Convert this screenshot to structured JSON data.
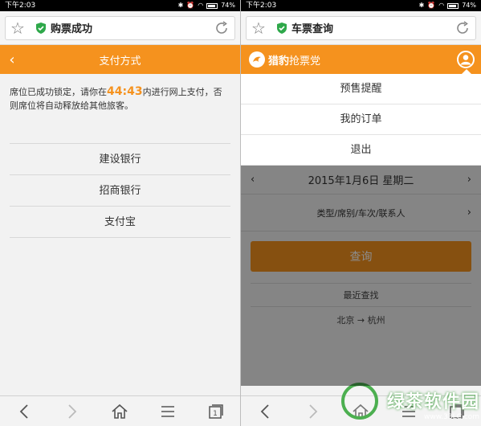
{
  "left": {
    "status": {
      "time": "下午2:03",
      "battery": "74%"
    },
    "urlbar": {
      "title": "购票成功"
    },
    "header": {
      "title": "支付方式"
    },
    "notice": {
      "before": "席位已成功锁定，请你在",
      "countdown": "44:43",
      "after": "内进行网上支付，否则席位将自动释放给其他旅客。"
    },
    "payment_options": [
      "建设银行",
      "招商银行",
      "支付宝"
    ],
    "bottomnav": {
      "tabs_count": "1"
    }
  },
  "right": {
    "status": {
      "time": "下午2:03",
      "battery": "74%"
    },
    "urlbar": {
      "title": "车票查询"
    },
    "header": {
      "logo_bold": "猎豹",
      "logo_rest": "抢票党"
    },
    "menu": [
      "预售提醒",
      "我的订单",
      "退出"
    ],
    "date": "2015年1月6日  星期二",
    "filter": "类型/席别/车次/联系人",
    "search_label": "查询",
    "recent_title": "最近查找",
    "recent": {
      "from": "北京",
      "arrow": "→",
      "to": "杭州"
    },
    "watermark": {
      "main": "绿茶软件园",
      "url": "www.33LC.com"
    }
  },
  "colors": {
    "accent": "#f5921e",
    "shield": "#2ea84a"
  }
}
